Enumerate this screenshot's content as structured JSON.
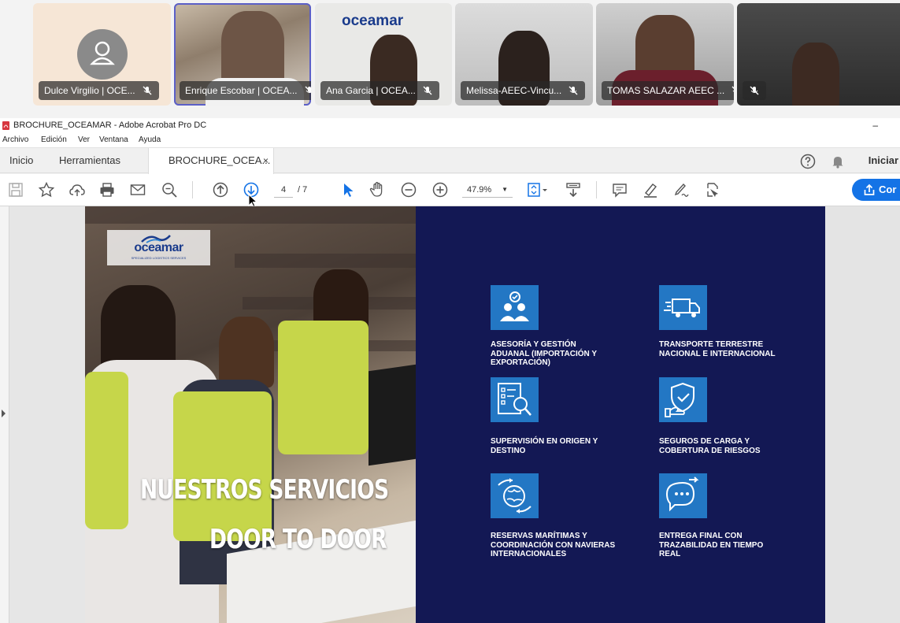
{
  "video_call": {
    "participants": [
      {
        "name": "Dulce Virgilio | OCE...",
        "muted": true
      },
      {
        "name": "Enrique Escobar | OCEA...",
        "muted": true,
        "active_speaker": true
      },
      {
        "name": "Ana Garcia | OCEA...",
        "muted": true
      },
      {
        "name": "Melissa-AEEC-Vincu...",
        "muted": true
      },
      {
        "name": "TOMAS SALAZAR AEEC ...",
        "muted": true
      },
      {
        "name": "",
        "muted": true
      }
    ]
  },
  "acrobat": {
    "window_title": "BROCHURE_OCEAMAR - Adobe Acrobat Pro DC",
    "minimize": "–",
    "menu": [
      "Archivo",
      "Edición",
      "Ver",
      "Ventana",
      "Ayuda"
    ],
    "tabs": {
      "home": "Inicio",
      "tools": "Herramientas",
      "document": "BROCHURE_OCEA...",
      "close": "×"
    },
    "sign_in": "Iniciar",
    "toolbar": {
      "page_current": "4",
      "page_total": "/ 7",
      "zoom": "47.9%",
      "share_label": "Cor"
    }
  },
  "brochure": {
    "logo": "oceamar",
    "logo_sub": "SPECIALIZED LOGISTICS SERVICES",
    "headline_line1": "NUESTROS SERVICIOS",
    "headline_line2": "DOOR TO DOOR",
    "services": [
      {
        "icon": "advisory-icon",
        "text": "ASESORÍA Y GESTIÓN ADUANAL (IMPORTACIÓN Y EXPORTACIÓN)"
      },
      {
        "icon": "truck-icon",
        "text": "TRANSPORTE TERRESTRE NACIONAL E INTERNACIONAL"
      },
      {
        "icon": "inspection-icon",
        "text": "SUPERVISIÓN EN ORIGEN Y DESTINO"
      },
      {
        "icon": "insurance-icon",
        "text": "SEGUROS DE CARGA Y COBERTURA DE RIESGOS"
      },
      {
        "icon": "maritime-booking-icon",
        "text": "RESERVAS MARÍTIMAS Y COORDINACIÓN CON NAVIERAS INTERNACIONALES"
      },
      {
        "icon": "tracking-icon",
        "text": "ENTREGA FINAL CON TRAZABILIDAD EN TIEMPO REAL"
      }
    ]
  },
  "colors": {
    "panel_navy": "#131854",
    "icon_blue": "#2377c4",
    "share_blue": "#1473e6",
    "vest_yellow": "#c6d64a"
  }
}
